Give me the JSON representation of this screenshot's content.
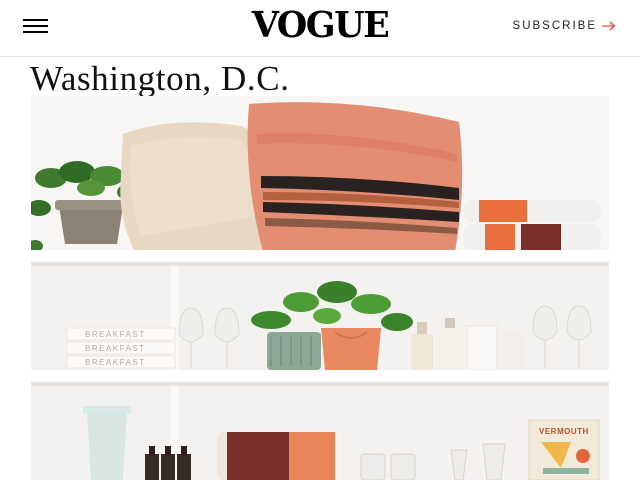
{
  "header": {
    "menu_icon": "hamburger-menu-icon",
    "logo": "VOGUE",
    "subscribe_label": "SUBSCRIBE",
    "subscribe_icon": "arrow-right-icon",
    "accent_color": "#e8433a"
  },
  "page": {
    "title": "Washington, D.C."
  },
  "hero_image": {
    "box_labels": [
      "BREAKFAST",
      "BREAKFAST",
      "BREAKFAST"
    ],
    "book_title": "VERMOUTH"
  }
}
